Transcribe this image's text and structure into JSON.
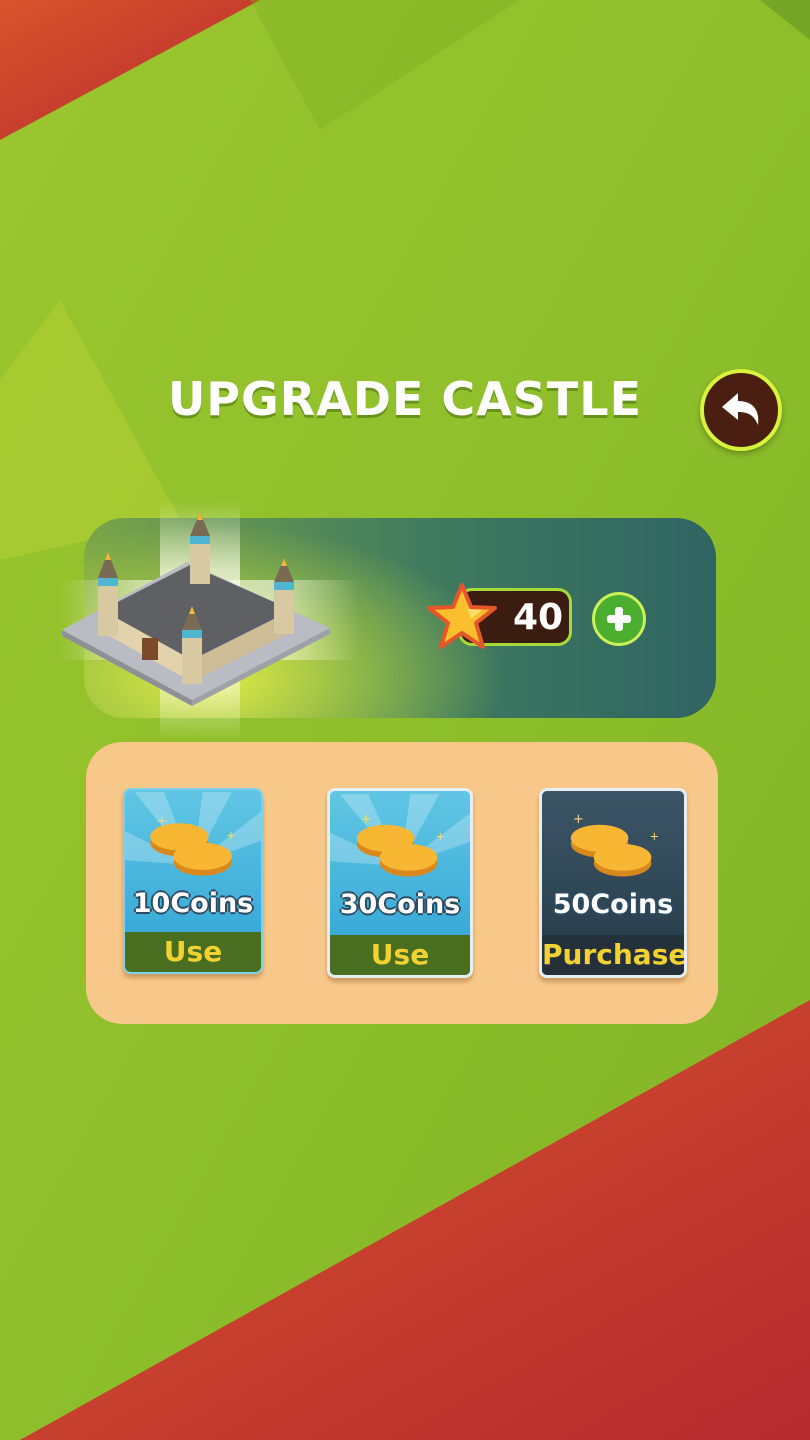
{
  "header": {
    "title": "UPGRADE CASTLE"
  },
  "castle": {
    "stars": "40"
  },
  "offers": [
    {
      "amount": "10Coins",
      "action": "Use"
    },
    {
      "amount": "30Coins",
      "action": "Use"
    },
    {
      "amount": "50Coins",
      "action": "Purchase"
    }
  ],
  "colors": {
    "background_green": "#8cbf2a",
    "corner_red": "#c8362b",
    "panel_orange": "#f8c88a",
    "action_text": "#f2d233"
  },
  "icons": {
    "back": "back-arrow-icon",
    "star": "star-icon",
    "add": "plus-icon",
    "coins": "coin-stack-icon"
  }
}
